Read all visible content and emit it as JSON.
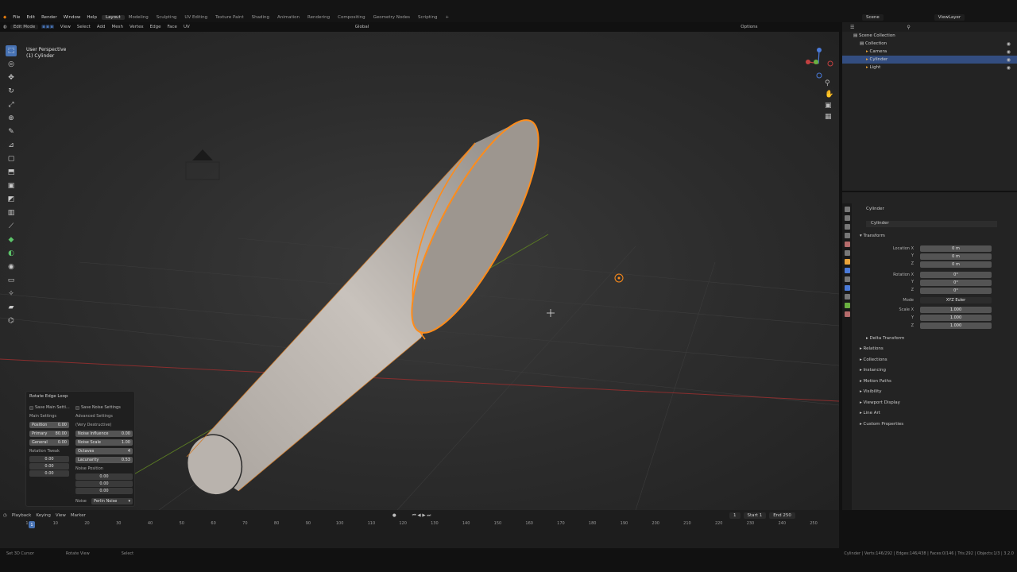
{
  "menus": [
    "Blender",
    "File",
    "Edit",
    "Render",
    "Window",
    "Help"
  ],
  "workspaces": [
    {
      "label": "Layout",
      "active": true
    },
    {
      "label": "Modeling"
    },
    {
      "label": "Sculpting"
    },
    {
      "label": "UV Editing"
    },
    {
      "label": "Texture Paint"
    },
    {
      "label": "Shading"
    },
    {
      "label": "Animation"
    },
    {
      "label": "Rendering"
    },
    {
      "label": "Compositing"
    },
    {
      "label": "Geometry Nodes"
    },
    {
      "label": "Scripting"
    }
  ],
  "scene": "Scene",
  "view_layer": "ViewLayer",
  "viewport_header": {
    "mode": "Edit Mode",
    "menus": [
      "View",
      "Select",
      "Add",
      "Mesh",
      "Vertex",
      "Edge",
      "Face",
      "UV"
    ],
    "orientation": "Global",
    "options": "Options"
  },
  "overlay_text": {
    "view": "User Perspective",
    "object": "(1) Cylinder"
  },
  "operator_panel": {
    "title": "Rotate Edge Loop",
    "save_main": "Save Main Setti...",
    "save_noise": "Save Noise Settings",
    "main_settings": "Main Settings",
    "advanced_settings": "Advanced Settings",
    "very_destructive": "(Very Destructive)",
    "position": {
      "label": "Position",
      "value": "0.00"
    },
    "primary": {
      "label": "Primary",
      "value": "80.00"
    },
    "general": {
      "label": "General",
      "value": "0.00"
    },
    "noise_influence": {
      "label": "Noise Influence",
      "value": "0.00"
    },
    "noise_scale": {
      "label": "Noise Scale",
      "value": "1.00"
    },
    "octaves": {
      "label": "Octaves",
      "value": "4"
    },
    "lacunarity": {
      "label": "Lacunarity",
      "value": "0.53"
    },
    "rotation_tweak": "Rotation Tweak",
    "rotation_values": [
      "0.00",
      "0.00",
      "0.00"
    ],
    "noise_position": "Noise Position",
    "noise_position_values": [
      "0.00",
      "0.00",
      "0.00"
    ],
    "noise_label": "Noise",
    "noise_type": "Perlin Noise"
  },
  "outliner": {
    "items": [
      {
        "label": "Scene Collection",
        "indent": 0
      },
      {
        "label": "Collection",
        "indent": 1
      },
      {
        "label": "Camera",
        "indent": 2
      },
      {
        "label": "Cylinder",
        "indent": 2,
        "selected": true
      },
      {
        "label": "Light",
        "indent": 2
      }
    ]
  },
  "properties": {
    "object": "Cylinder",
    "data_name": "Cylinder",
    "transform": "Transform",
    "location_label": "Location X",
    "location": [
      "0 m",
      "0 m",
      "0 m"
    ],
    "rotation_label": "Rotation X",
    "rotation": [
      "0°",
      "0°",
      "0°"
    ],
    "mode_label": "Mode",
    "mode": "XYZ Euler",
    "scale_label": "Scale X",
    "scale": [
      "1.000",
      "1.000",
      "1.000"
    ],
    "axis_y": "Y",
    "axis_z": "Z",
    "sections": [
      "Delta Transform",
      "Relations",
      "Collections",
      "Instancing",
      "Motion Paths",
      "Visibility",
      "Viewport Display",
      "Line Art",
      "Custom Properties"
    ]
  },
  "timeline": {
    "menus": [
      "Playback",
      "Keying",
      "View",
      "Marker"
    ],
    "current_frame": "1",
    "start_label": "Start",
    "start": "1",
    "end_label": "End",
    "end": "250",
    "ticks": [
      "1",
      "10",
      "20",
      "30",
      "40",
      "50",
      "60",
      "70",
      "80",
      "90",
      "100",
      "110",
      "120",
      "130",
      "140",
      "150",
      "160",
      "170",
      "180",
      "190",
      "200",
      "210",
      "220",
      "230",
      "240",
      "250"
    ]
  },
  "status": {
    "hints": [
      "Set 3D Cursor",
      "Rotate View",
      "Select"
    ],
    "stats": "Cylinder | Verts:146/292 | Edges:146/438 | Faces:0/146 | Tris:292 | Objects:1/3 | 3.2.0"
  },
  "colors": {
    "accent": "#4772b3",
    "selection": "#ff8c1a",
    "x_axis": "#b33a3a",
    "y_axis": "#6a9a2a"
  }
}
